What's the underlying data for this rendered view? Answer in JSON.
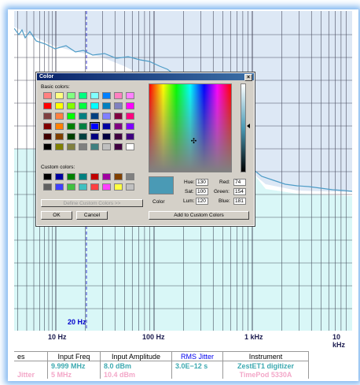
{
  "dialog": {
    "title": "Color",
    "close": "×",
    "basic_label": "Basic colors:",
    "custom_label": "Custom colors:",
    "define_button": "Define Custom Colors >>",
    "ok_button": "OK",
    "cancel_button": "Cancel",
    "add_button": "Add to Custom Colors",
    "color_label": "Color",
    "hue_label": "Hue:",
    "hue": "130",
    "sat_label": "Sat:",
    "sat": "100",
    "lum_label": "Lum:",
    "lum": "120",
    "red_label": "Red:",
    "red": "74",
    "green_label": "Green:",
    "green": "154",
    "blue_label": "Blue:",
    "blue": "181",
    "current_color": "#4a9ab5",
    "basic_colors": [
      "#ff8080",
      "#ffff80",
      "#80ff80",
      "#00ff80",
      "#80ffff",
      "#0080ff",
      "#ff80c0",
      "#ff80ff",
      "#ff0000",
      "#ffff00",
      "#80ff00",
      "#00ff40",
      "#00ffff",
      "#0080c0",
      "#8080c0",
      "#ff00ff",
      "#804040",
      "#ff8040",
      "#00ff00",
      "#008080",
      "#004080",
      "#8080ff",
      "#800040",
      "#ff0080",
      "#800000",
      "#ff8000",
      "#008000",
      "#008040",
      "#0000ff",
      "#0000a0",
      "#800080",
      "#8000ff",
      "#400000",
      "#804000",
      "#004000",
      "#004040",
      "#000080",
      "#000040",
      "#400040",
      "#400080",
      "#000000",
      "#808000",
      "#808040",
      "#808080",
      "#408080",
      "#c0c0c0",
      "#400040",
      "#ffffff"
    ],
    "selected_basic": 28,
    "custom_colors": [
      "#000000",
      "#0000a0",
      "#008000",
      "#008080",
      "#c00000",
      "#a000a0",
      "#804000",
      "#808080",
      "#606060",
      "#4040ff",
      "#40c040",
      "#40c0c0",
      "#ff4040",
      "#ff40ff",
      "#ffff40",
      "#c0c0c0"
    ]
  },
  "plot": {
    "x_ticks": [
      "10 Hz",
      "100 Hz",
      "1 kHz",
      "10 kHz"
    ],
    "marker_label": "20 Hz"
  },
  "table": {
    "headers": [
      "es",
      "Input Freq",
      "Input Amplitude",
      "RMS Jitter",
      "Instrument"
    ],
    "rows": [
      [
        "",
        "9.999 MHz",
        "8.0 dBm",
        "3.0E−12 s",
        "ZestET1 digitizer"
      ],
      [
        "Jitter",
        "5 MHz",
        "10.4 dBm",
        "",
        "TimePod 5330A"
      ]
    ]
  },
  "colors": {
    "trace": "#4e9cc7",
    "shade_top": "#dde8f5",
    "shade_bottom": "#d9f7f7",
    "grid": "#1a1a2e",
    "marker": "#3333cc"
  }
}
